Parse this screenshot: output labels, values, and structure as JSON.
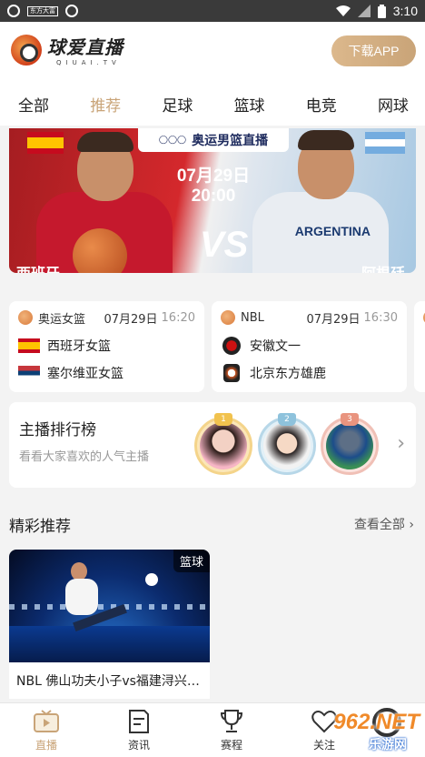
{
  "status_bar": {
    "badge": "东方大富",
    "time": "3:10"
  },
  "header": {
    "app_name": "球爱直播",
    "app_subtitle": "QIUAI.TV",
    "download_label": "下载APP"
  },
  "tabs": [
    {
      "label": "全部"
    },
    {
      "label": "推荐",
      "active": true
    },
    {
      "label": "足球"
    },
    {
      "label": "篮球"
    },
    {
      "label": "电竞"
    },
    {
      "label": "网球"
    }
  ],
  "banner": {
    "title": "奥运男篮直播",
    "date": "07月29日",
    "time": "20:00",
    "vs": "VS",
    "team_left": "西班牙",
    "team_right": "阿根廷",
    "jersey_text": "ARGENTINA"
  },
  "matches": [
    {
      "league": "奥运女篮",
      "date": "07月29日",
      "time": "16:20",
      "home": "西班牙女篮",
      "away": "塞尔维亚女篮"
    },
    {
      "league": "NBL",
      "date": "07月29日",
      "time": "16:30",
      "home": "安徽文一",
      "away": "北京东方雄鹿"
    }
  ],
  "ranking": {
    "title": "主播排行榜",
    "subtitle": "看看大家喜欢的人气主播",
    "ranks": [
      "1",
      "2",
      "3"
    ]
  },
  "featured": {
    "title": "精彩推荐",
    "see_all": "查看全部 ›"
  },
  "video": {
    "tag": "篮球",
    "title": "NBL 佛山功夫小子vs福建浔兴股份"
  },
  "bottom_nav": [
    {
      "label": "直播",
      "icon": "tv-icon",
      "active": true
    },
    {
      "label": "资讯",
      "icon": "news-icon"
    },
    {
      "label": "赛程",
      "icon": "trophy-icon"
    },
    {
      "label": "关注",
      "icon": "heart-icon"
    }
  ],
  "watermark": {
    "brand": "962.NET",
    "cn": "乐游网"
  },
  "colors": {
    "accent": "#c9a478",
    "status_bar": "#3a3a3a"
  }
}
